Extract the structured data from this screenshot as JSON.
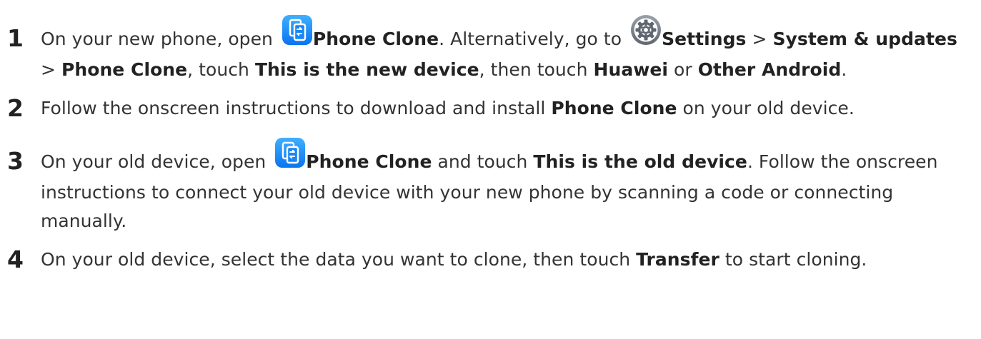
{
  "steps": [
    {
      "number": "1",
      "t1": "On your new phone, open ",
      "b1": "Phone Clone",
      "t2": ". Alternatively, go to ",
      "b2": "Settings",
      "t3": " > ",
      "b3": "System & updates",
      "t4": " > ",
      "b4": "Phone Clone",
      "t5": ", touch ",
      "b5": "This is the new device",
      "t6": ", then touch ",
      "b6": "Huawei",
      "t7": " or ",
      "b7": "Other Android",
      "t8": "."
    },
    {
      "number": "2",
      "t1": "Follow the onscreen instructions to download and install ",
      "b1": "Phone Clone",
      "t2": " on your old device."
    },
    {
      "number": "3",
      "t1": "On your old device, open ",
      "b1": "Phone Clone",
      "t2": " and touch ",
      "b2": "This is the old device",
      "t3": ". Follow the onscreen instructions to connect your old device with your new phone by scanning a code or connecting manually."
    },
    {
      "number": "4",
      "t1": "On your old device, select the data you want to clone, then touch ",
      "b1": "Transfer",
      "t2": " to start cloning."
    }
  ],
  "icons": {
    "phone_clone": "phone-clone-icon",
    "settings": "settings-gear-icon",
    "phone_clone_color": "#1a8cff",
    "settings_color": "#8a8f99"
  }
}
